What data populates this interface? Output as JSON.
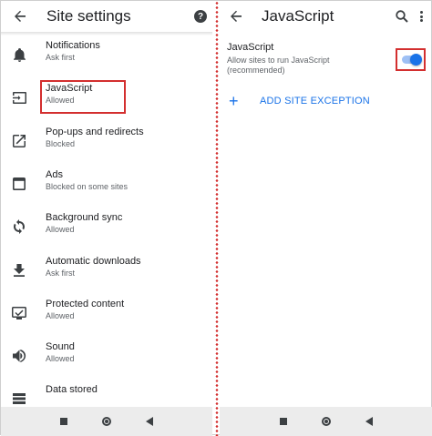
{
  "left": {
    "title": "Site settings",
    "items": [
      {
        "label": "Notifications",
        "sub": "Ask first"
      },
      {
        "label": "JavaScript",
        "sub": "Allowed"
      },
      {
        "label": "Pop-ups and redirects",
        "sub": "Blocked"
      },
      {
        "label": "Ads",
        "sub": "Blocked on some sites"
      },
      {
        "label": "Background sync",
        "sub": "Allowed"
      },
      {
        "label": "Automatic downloads",
        "sub": "Ask first"
      },
      {
        "label": "Protected content",
        "sub": "Allowed"
      },
      {
        "label": "Sound",
        "sub": "Allowed"
      },
      {
        "label": "Data stored",
        "sub": ""
      }
    ],
    "help_glyph": "?"
  },
  "right": {
    "title": "JavaScript",
    "setting_label": "JavaScript",
    "setting_desc": "Allow sites to run JavaScript (recommended)",
    "toggle_on": true,
    "add_exception_label": "ADD SITE EXCEPTION",
    "add_glyph": "+"
  },
  "colors": {
    "accent": "#1a73e8",
    "highlight": "#d32f2f"
  }
}
